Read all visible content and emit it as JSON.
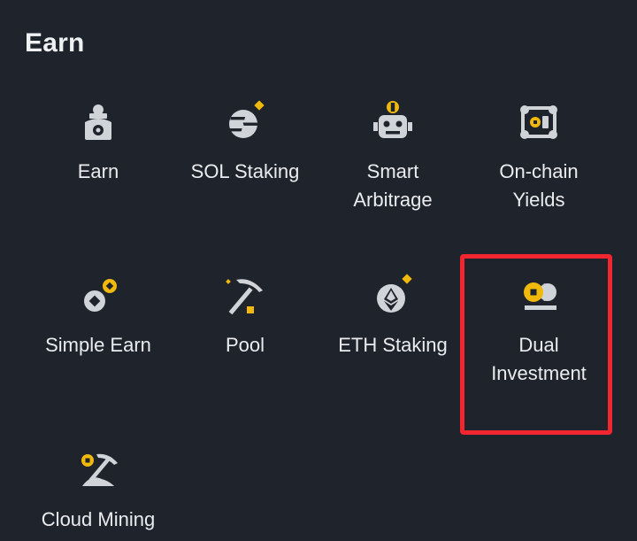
{
  "section": {
    "title": "Earn"
  },
  "tiles": [
    {
      "label": "Earn",
      "icon": "earn-icon"
    },
    {
      "label": "SOL Staking",
      "icon": "sol-staking-icon"
    },
    {
      "label": "Smart\nArbitrage",
      "icon": "smart-arbitrage-icon"
    },
    {
      "label": "On-chain\nYields",
      "icon": "on-chain-yields-icon"
    },
    {
      "label": "Simple Earn",
      "icon": "simple-earn-icon"
    },
    {
      "label": "Pool",
      "icon": "pool-icon"
    },
    {
      "label": "ETH Staking",
      "icon": "eth-staking-icon"
    },
    {
      "label": "Dual\nInvestment",
      "icon": "dual-investment-icon"
    },
    {
      "label": "Cloud Mining",
      "icon": "cloud-mining-icon"
    }
  ],
  "colors": {
    "background": "#1f232b",
    "icon_gray": "#d0d3d8",
    "accent_yellow": "#f0b90b",
    "highlight_red": "#f2262f"
  }
}
